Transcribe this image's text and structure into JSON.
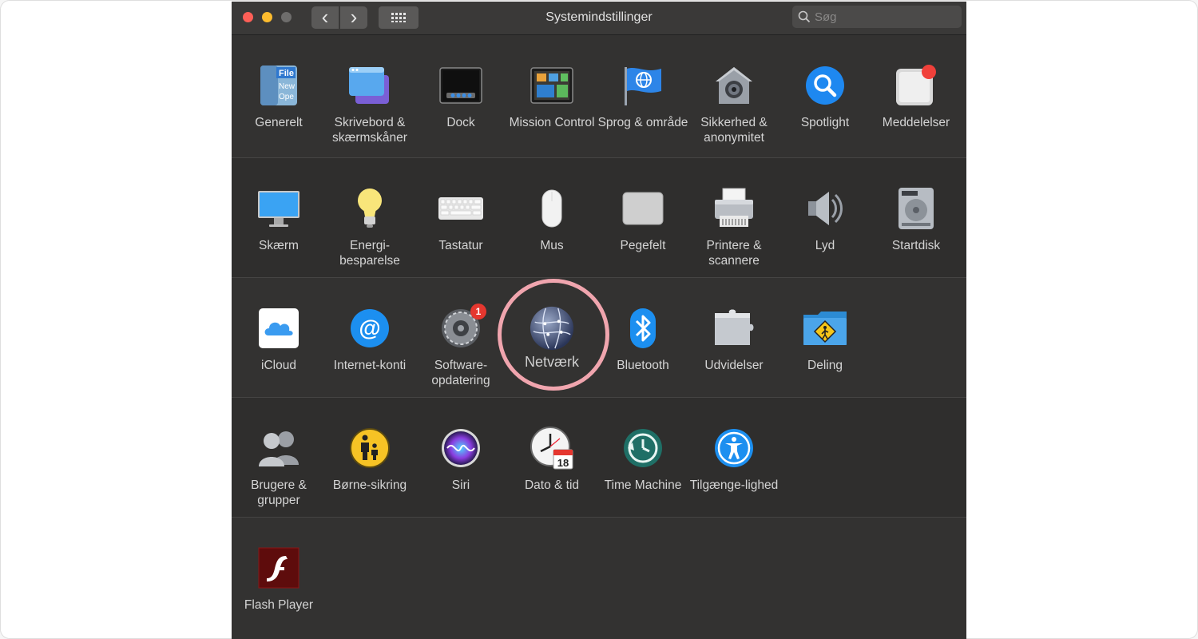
{
  "window": {
    "title": "Systemindstillinger",
    "search_placeholder": "Søg",
    "back_glyph": "‹",
    "forward_glyph": "›",
    "grid_glyph": "⠿"
  },
  "rows": [
    [
      {
        "id": "generelt",
        "label": "Generelt",
        "icon": "general-file-icon"
      },
      {
        "id": "skrivebord",
        "label": "Skrivebord & skærmskåner",
        "icon": "desktop-screensaver-icon"
      },
      {
        "id": "dock",
        "label": "Dock",
        "icon": "dock-icon"
      },
      {
        "id": "mission",
        "label": "Mission Control",
        "icon": "mission-control-icon"
      },
      {
        "id": "sprog",
        "label": "Sprog & område",
        "icon": "language-flag-icon"
      },
      {
        "id": "sikkerhed",
        "label": "Sikkerhed & anonymitet",
        "icon": "security-house-icon"
      },
      {
        "id": "spotlight",
        "label": "Spotlight",
        "icon": "spotlight-magnifier-icon"
      },
      {
        "id": "meddelelser",
        "label": "Meddelelser",
        "icon": "notifications-icon"
      }
    ],
    [
      {
        "id": "skaerm",
        "label": "Skærm",
        "icon": "display-monitor-icon"
      },
      {
        "id": "energi",
        "label": "Energi-besparelse",
        "icon": "energy-bulb-icon"
      },
      {
        "id": "tastatur",
        "label": "Tastatur",
        "icon": "keyboard-icon"
      },
      {
        "id": "mus",
        "label": "Mus",
        "icon": "mouse-icon"
      },
      {
        "id": "pegefelt",
        "label": "Pegefelt",
        "icon": "trackpad-icon"
      },
      {
        "id": "printere",
        "label": "Printere & scannere",
        "icon": "printer-icon"
      },
      {
        "id": "lyd",
        "label": "Lyd",
        "icon": "speaker-icon"
      },
      {
        "id": "startdisk",
        "label": "Startdisk",
        "icon": "startup-disk-icon"
      }
    ],
    [
      {
        "id": "icloud",
        "label": "iCloud",
        "icon": "icloud-icon"
      },
      {
        "id": "internetkonti",
        "label": "Internet-konti",
        "icon": "internet-accounts-at-icon"
      },
      {
        "id": "software",
        "label": "Software-opdatering",
        "icon": "software-update-gear-icon",
        "badge": "1"
      },
      {
        "id": "netvaerk",
        "label": "Netværk",
        "icon": "network-globe-icon"
      },
      {
        "id": "bluetooth",
        "label": "Bluetooth",
        "icon": "bluetooth-icon"
      },
      {
        "id": "udvidelser",
        "label": "Udvidelser",
        "icon": "extensions-puzzle-icon"
      },
      {
        "id": "deling",
        "label": "Deling",
        "icon": "sharing-folder-icon"
      }
    ],
    [
      {
        "id": "brugere",
        "label": "Brugere & grupper",
        "icon": "users-groups-icon"
      },
      {
        "id": "boernesikring",
        "label": "Børne-sikring",
        "icon": "parental-controls-icon"
      },
      {
        "id": "siri",
        "label": "Siri",
        "icon": "siri-icon"
      },
      {
        "id": "dato",
        "label": "Dato & tid",
        "icon": "date-time-clock-icon"
      },
      {
        "id": "timemachine",
        "label": "Time Machine",
        "icon": "time-machine-icon"
      },
      {
        "id": "tilgaengelighed",
        "label": "Tilgænge-lighed",
        "icon": "accessibility-icon"
      }
    ],
    [
      {
        "id": "flash",
        "label": "Flash Player",
        "icon": "flash-player-icon"
      }
    ]
  ],
  "highlighted_item": "Netværk",
  "colors": {
    "window_bg": "#333231",
    "highlight_ring": "#f0a5ae",
    "badge": "#e5372f"
  }
}
